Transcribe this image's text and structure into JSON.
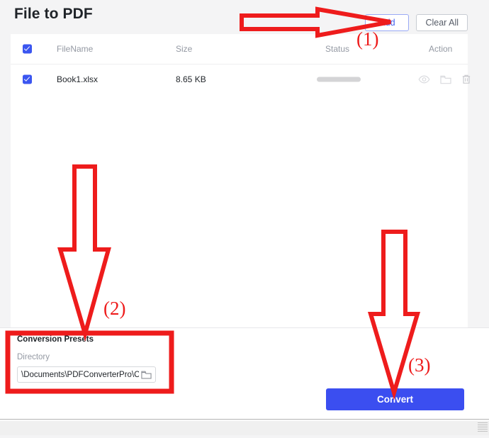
{
  "window": {
    "title": "File to PDF"
  },
  "header": {
    "title": "File to PDF",
    "buttons": {
      "add": "Add",
      "clear_all": "Clear All"
    },
    "accent_color": "#4361ee"
  },
  "file_table": {
    "columns": [
      "FileName",
      "Size",
      "Status",
      "Action"
    ],
    "select_all_checked": true,
    "rows": [
      {
        "checked": true,
        "filename": "Book1.xlsx",
        "size": "8.65 KB",
        "status_progress": 0,
        "actions": [
          "eye-icon",
          "folder-icon",
          "trash-icon"
        ]
      }
    ]
  },
  "presets": {
    "section_title": "Conversion Presets",
    "directory_label": "Directory",
    "directory_value": "\\Documents\\PDFConverterPro\\Create",
    "browse_icon": "folder-icon"
  },
  "footer": {
    "convert_label": "Convert",
    "convert_color": "#3b4ef0"
  },
  "annotations": {
    "color": "#ee1c1c",
    "markers": [
      {
        "id": "1",
        "label": "(1)",
        "target": "add-button",
        "direction": "right"
      },
      {
        "id": "2",
        "label": "(2)",
        "target": "conversion-presets",
        "direction": "down"
      },
      {
        "id": "3",
        "label": "(3)",
        "target": "convert-button",
        "direction": "down"
      }
    ]
  }
}
